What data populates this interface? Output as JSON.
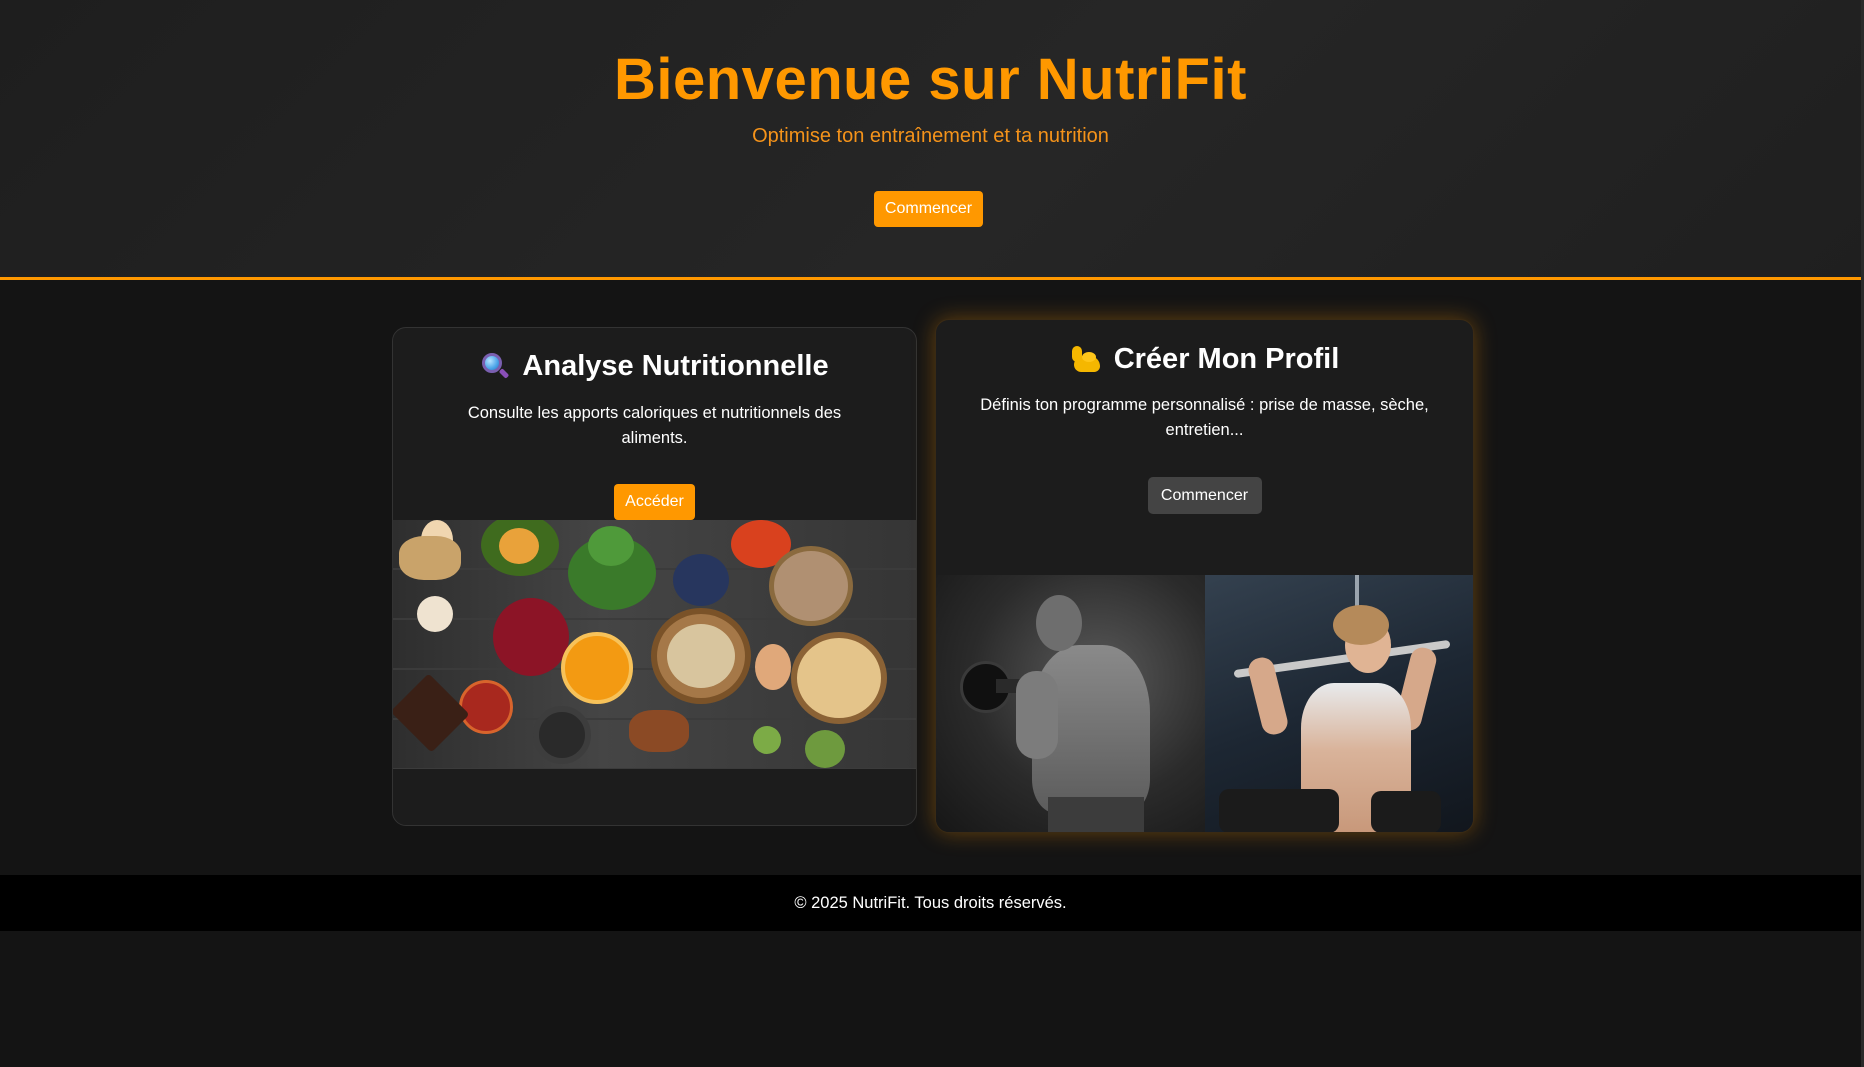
{
  "hero": {
    "title": "Bienvenue sur NutriFit",
    "subtitle": "Optimise ton entraînement et ta nutrition",
    "button_label": "Commencer"
  },
  "cards": [
    {
      "icon": "magnifier-icon",
      "title": "Analyse Nutritionnelle",
      "description": "Consulte les apports caloriques et nutritionnels des aliments.",
      "button_label": "Accéder",
      "image": "healthy-food-image"
    },
    {
      "icon": "flexed-biceps-icon",
      "title": "Créer Mon Profil",
      "description": "Définis ton programme personnalisé : prise de masse, sèche, entretien...",
      "button_label": "Commencer",
      "image": "gym-workout-image"
    }
  ],
  "footer": {
    "copyright": "© 2025 NutriFit. Tous droits réservés."
  },
  "colors": {
    "accent": "#ff9800",
    "background": "#141414",
    "hero_background": "#222222",
    "card_background": "#1c1c1c",
    "dark_button": "#444444",
    "footer_background": "#000000"
  }
}
